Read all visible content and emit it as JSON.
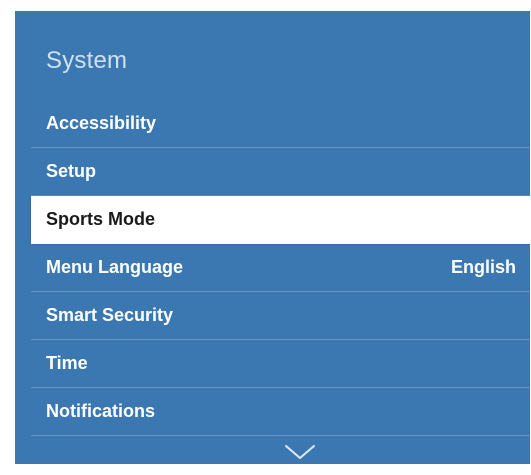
{
  "panel": {
    "title": "System",
    "items": [
      {
        "label": "Accessibility",
        "value": ""
      },
      {
        "label": "Setup",
        "value": ""
      },
      {
        "label": "Sports Mode",
        "value": ""
      },
      {
        "label": "Menu Language",
        "value": "English"
      },
      {
        "label": "Smart Security",
        "value": ""
      },
      {
        "label": "Time",
        "value": ""
      },
      {
        "label": "Notifications",
        "value": ""
      }
    ],
    "selected_index": 2,
    "scroll_icon": "chevron-down-icon"
  },
  "colors": {
    "panel_background": "#3b78b2",
    "title_text": "#cfe0f0",
    "item_text": "#ffffff",
    "selected_background": "#ffffff",
    "selected_text": "#1a1a1a"
  }
}
